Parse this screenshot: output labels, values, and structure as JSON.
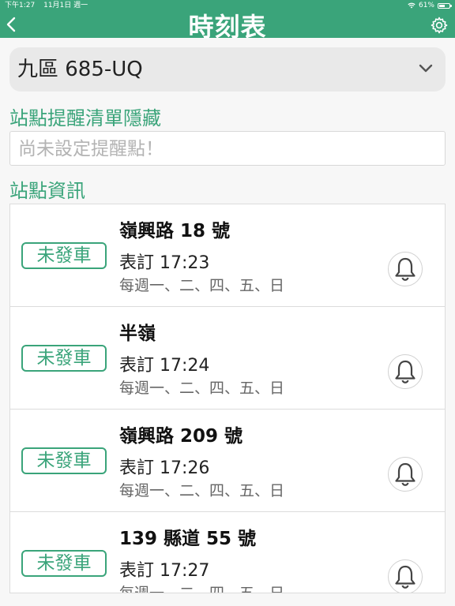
{
  "status_bar": {
    "time": "下午1:27",
    "date": "11月1日 週一",
    "battery": "61%",
    "battery_level": 0.61
  },
  "header": {
    "title": "時刻表"
  },
  "route_select": {
    "value": "九區 685-UQ"
  },
  "reminder_section": {
    "label": "站點提醒清單隱藏",
    "empty_text": "尚未設定提醒點！"
  },
  "stops_section": {
    "label": "站點資訊"
  },
  "stops": [
    {
      "status": "未發車",
      "name": "嶺興路 18 號",
      "schedule": "表訂 17:23",
      "days": "每週一、二、四、五、日"
    },
    {
      "status": "未發車",
      "name": "半嶺",
      "schedule": "表訂 17:24",
      "days": "每週一、二、四、五、日"
    },
    {
      "status": "未發車",
      "name": "嶺興路 209 號",
      "schedule": "表訂 17:26",
      "days": "每週一、二、四、五、日"
    },
    {
      "status": "未發車",
      "name": "139 縣道 55 號",
      "schedule": "表訂 17:27",
      "days": "每週一、二、四、五、日"
    }
  ],
  "colors": {
    "accent": "#3aa47a"
  }
}
